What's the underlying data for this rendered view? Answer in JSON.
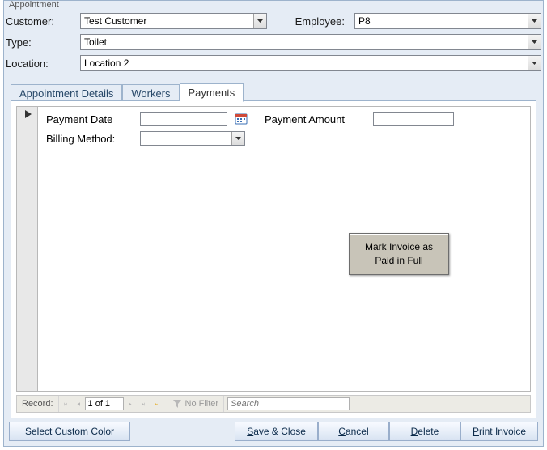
{
  "window": {
    "title": "Appointment"
  },
  "header": {
    "customer_label": "Customer:",
    "customer_value": "Test Customer",
    "employee_label": "Employee:",
    "employee_value": "P8",
    "type_label": "Type:",
    "type_value": "Toilet",
    "location_label": "Location:",
    "location_value": "Location 2"
  },
  "tabs": [
    {
      "label": "Appointment Details",
      "active": false
    },
    {
      "label": "Workers",
      "active": false
    },
    {
      "label": "Payments",
      "active": true
    }
  ],
  "payments": {
    "payment_date_label": "Payment Date",
    "payment_date_value": "",
    "payment_amount_label": "Payment Amount",
    "payment_amount_value": "",
    "billing_method_label": "Billing Method:",
    "billing_method_value": "",
    "mark_paid_button": "Mark Invoice as\nPaid in Full"
  },
  "recordnav": {
    "label": "Record:",
    "position": "1 of 1",
    "filter_label": "No Filter",
    "search_placeholder": "Search"
  },
  "footer": {
    "select_color": "Select Custom Color",
    "save_close_text": "ave & Close",
    "cancel_text": "ancel",
    "delete_text": "elete",
    "print_text": "rint Invoice",
    "accel": {
      "save": "S",
      "cancel": "C",
      "delete": "D",
      "print": "P"
    }
  }
}
